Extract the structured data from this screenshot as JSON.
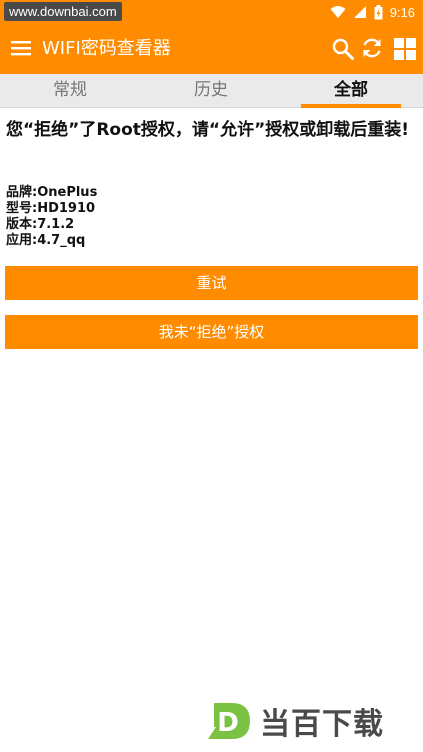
{
  "status_bar": {
    "watermark_url": "www.downbai.com",
    "time": "9:16",
    "icons": [
      "wifi-icon",
      "signal-icon",
      "battery-icon"
    ]
  },
  "app_bar": {
    "title": "WIFI密码查看器",
    "icons": [
      "menu-icon",
      "search-icon",
      "refresh-icon",
      "grid-icon"
    ]
  },
  "tabs": [
    {
      "label": "常规",
      "active": false
    },
    {
      "label": "历史",
      "active": false
    },
    {
      "label": "全部",
      "active": true
    }
  ],
  "message": "您“拒绝”了Root授权，请“允许”授权或卸载后重装!",
  "device_info": [
    {
      "label": "品牌:",
      "value": "OnePlus"
    },
    {
      "label": "型号:",
      "value": "HD1910"
    },
    {
      "label": "版本:",
      "value": "7.1.2"
    },
    {
      "label": "应用:",
      "value": "4.7_qq"
    }
  ],
  "buttons": {
    "retry": "重试",
    "not_denied": "我未“拒绝”授权"
  },
  "watermark_logo": {
    "letter": "D",
    "text": "当百下载"
  },
  "colors": {
    "accent": "#ff8c00",
    "tab_bar_bg": "#eaeaea",
    "logo_green": "#7cc242"
  }
}
